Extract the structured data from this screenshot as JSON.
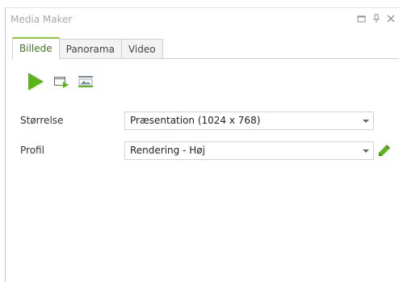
{
  "panel": {
    "title": "Media Maker"
  },
  "window_controls": {
    "restore_icon": "restore-icon",
    "pin_icon": "pin-icon",
    "close_icon": "close-icon"
  },
  "tabs": [
    {
      "label": "Billede",
      "active": true
    },
    {
      "label": "Panorama",
      "active": false
    },
    {
      "label": "Video",
      "active": false
    }
  ],
  "toolbar": {
    "items": [
      "play-icon",
      "render-to-window-icon",
      "image-settings-icon"
    ]
  },
  "form": {
    "size": {
      "label": "Størrelse",
      "value": "Præsentation (1024 x 768)"
    },
    "profile": {
      "label": "Profil",
      "value": "Rendering - Høj"
    }
  },
  "colors": {
    "accent_green": "#8dc63f",
    "play_green": "#5bb514"
  }
}
